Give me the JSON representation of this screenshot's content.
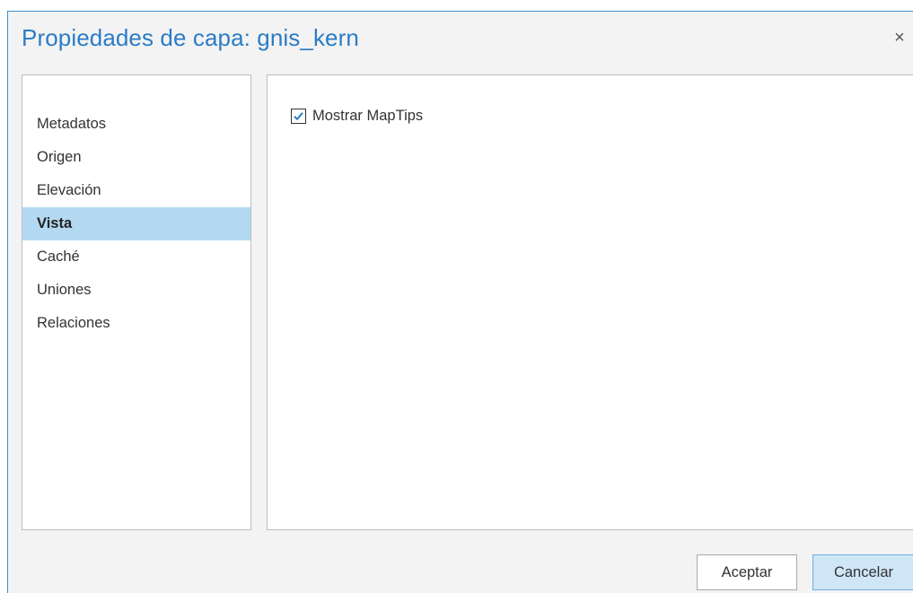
{
  "dialog": {
    "title": "Propiedades de capa: gnis_kern",
    "close_symbol": "×"
  },
  "sidebar": {
    "items": [
      {
        "label": "Metadatos",
        "selected": false
      },
      {
        "label": "Origen",
        "selected": false
      },
      {
        "label": "Elevación",
        "selected": false
      },
      {
        "label": "Vista",
        "selected": true
      },
      {
        "label": "Caché",
        "selected": false
      },
      {
        "label": "Uniones",
        "selected": false
      },
      {
        "label": "Relaciones",
        "selected": false
      }
    ]
  },
  "content": {
    "show_maptips": {
      "label": "Mostrar MapTips",
      "checked": true
    }
  },
  "buttons": {
    "accept_label": "Aceptar",
    "cancel_label": "Cancelar"
  },
  "colors": {
    "accent": "#2b7cc5",
    "selection": "#b3d9f2",
    "cancel_button": "#cfe6f7"
  }
}
